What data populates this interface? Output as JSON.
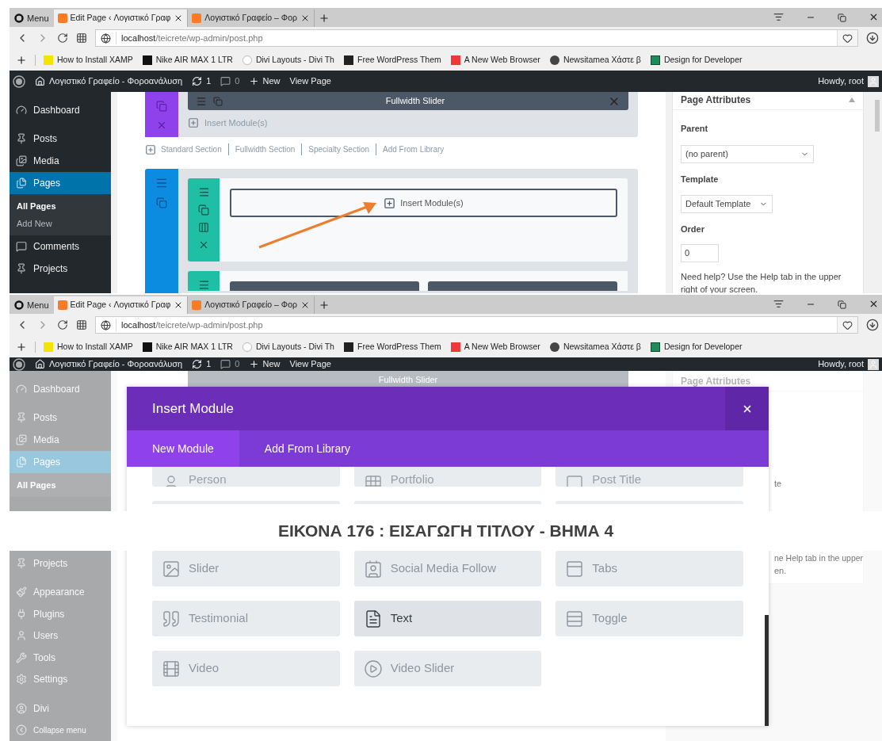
{
  "screenshots": [
    {
      "browser": {
        "menu": "Menu",
        "tabs": [
          {
            "title": "Edit Page ‹ Λογιστικό Γραφ",
            "selected": true
          },
          {
            "title": "Λογιστικό Γραφείο – Φορ",
            "selected": false
          }
        ],
        "address": {
          "host": "localhost",
          "path": "/teicrete/wp-admin/post.php"
        },
        "bookmarks": [
          {
            "label": "How to Install XAMP",
            "kind": "xampp"
          },
          {
            "label": "Nike AIR MAX 1 LTR",
            "kind": "nike"
          },
          {
            "label": "Divi Layouts - Divi Th",
            "kind": "divi"
          },
          {
            "label": "Free WordPress Them",
            "kind": "page"
          },
          {
            "label": "A New Web Browser",
            "kind": "vivaldi"
          },
          {
            "label": "Newsitamea Χάστε β",
            "kind": "news"
          },
          {
            "label": "Design for Developer",
            "kind": "design"
          }
        ]
      },
      "admin_bar": {
        "site": "Λογιστικό Γραφείο - Φοροανάλυση",
        "updates": "1",
        "comments": "0",
        "new": "New",
        "view": "View Page",
        "howdy": "Howdy, root"
      },
      "sidebar": [
        {
          "label": "Dashboard",
          "kind": "dashboard",
          "selected": false
        },
        {
          "label": "Posts",
          "kind": "pin",
          "selected": false
        },
        {
          "label": "Media",
          "kind": "media",
          "selected": false
        },
        {
          "label": "Pages",
          "kind": "pages",
          "selected": true,
          "children": [
            {
              "label": "All Pages",
              "selected": true
            },
            {
              "label": "Add New",
              "selected": false
            }
          ]
        },
        {
          "label": "Comments",
          "kind": "comments",
          "selected": false
        },
        {
          "label": "Projects",
          "kind": "pin",
          "selected": false
        }
      ],
      "builder": {
        "fullwidth_module": "Fullwidth Slider",
        "section_insert": "Insert Module(s)",
        "add_links": [
          "Standard Section",
          "Fullwidth Section",
          "Specialty Section",
          "Add From Library"
        ],
        "row_insert": "Insert Module(s)"
      },
      "page_attributes": {
        "title": "Page Attributes",
        "parent_label": "Parent",
        "parent_value": "(no parent)",
        "template_label": "Template",
        "template_value": "Default Template",
        "order_label": "Order",
        "order_value": "0",
        "help": "Need help? Use the Help tab in the upper right of your screen."
      }
    },
    {
      "browser": {
        "menu": "Menu",
        "tabs": [
          {
            "title": "Edit Page ‹ Λογιστικό Γραφ",
            "selected": true
          },
          {
            "title": "Λογιστικό Γραφείο – Φορ",
            "selected": false
          }
        ],
        "address": {
          "host": "localhost",
          "path": "/teicrete/wp-admin/post.php"
        },
        "bookmarks": [
          {
            "label": "How to Install XAMP",
            "kind": "xampp"
          },
          {
            "label": "Nike AIR MAX 1 LTR",
            "kind": "nike"
          },
          {
            "label": "Divi Layouts - Divi Th",
            "kind": "divi"
          },
          {
            "label": "Free WordPress Them",
            "kind": "page"
          },
          {
            "label": "A New Web Browser",
            "kind": "vivaldi"
          },
          {
            "label": "Newsitamea Χάστε β",
            "kind": "news"
          },
          {
            "label": "Design for Developer",
            "kind": "design"
          }
        ]
      },
      "admin_bar": {
        "site": "Λογιστικό Γραφείο - Φοροανάλυση",
        "updates": "1",
        "comments": "0",
        "new": "New",
        "view": "View Page",
        "howdy": "Howdy, root"
      },
      "sidebar_top": [
        {
          "label": "Dashboard",
          "kind": "dashboard",
          "selected": false
        },
        {
          "label": "Posts",
          "kind": "pin",
          "selected": false
        },
        {
          "label": "Media",
          "kind": "media",
          "selected": false
        },
        {
          "label": "Pages",
          "kind": "pages",
          "selected": true,
          "children": [
            {
              "label": "All Pages",
              "selected": true
            }
          ]
        }
      ],
      "sidebar_bottom": [
        {
          "label": "Projects",
          "kind": "pin",
          "selected": false
        },
        {
          "label": "Appearance",
          "kind": "brush",
          "selected": false
        },
        {
          "label": "Plugins",
          "kind": "plug",
          "selected": false
        },
        {
          "label": "Users",
          "kind": "user",
          "selected": false
        },
        {
          "label": "Tools",
          "kind": "wrench",
          "selected": false
        },
        {
          "label": "Settings",
          "kind": "settings",
          "selected": false
        },
        {
          "label": "Divi",
          "kind": "divi",
          "selected": false
        },
        {
          "label": "Collapse menu",
          "kind": "collapse",
          "selected": false
        }
      ],
      "background": {
        "fullwidth_module": "Fullwidth Slider",
        "panel_title": "Page Attributes",
        "template_fragment": "te",
        "help_fragment": "ne Help tab in the upper",
        "help_fragment_2": "en."
      },
      "modal": {
        "title": "Insert Module",
        "tabs": [
          {
            "label": "New Module",
            "selected": true
          },
          {
            "label": "Add From Library",
            "selected": false
          }
        ],
        "partial_modules": [
          {
            "label": "Person",
            "kind": "person"
          },
          {
            "label": "Portfolio",
            "kind": "grid"
          },
          {
            "label": "Post Title",
            "kind": "title"
          }
        ],
        "modules": [
          {
            "label": "Slider",
            "kind": "slider",
            "selected": false
          },
          {
            "label": "Social Media Follow",
            "kind": "social",
            "selected": false
          },
          {
            "label": "Tabs",
            "kind": "tabs",
            "selected": false
          },
          {
            "label": "Testimonial",
            "kind": "quote",
            "selected": false
          },
          {
            "label": "Text",
            "kind": "text",
            "selected": true
          },
          {
            "label": "Toggle",
            "kind": "toggle",
            "selected": false
          },
          {
            "label": "Video",
            "kind": "video",
            "selected": false
          },
          {
            "label": "Video Slider",
            "kind": "videoslider",
            "selected": false
          }
        ]
      }
    }
  ],
  "caption": "ΕΙΚΟΝΑ 176 : ΕΙΣΑΓΩΓΗ ΤΙΤΛΟΥ - ΒΗΜΑ 4"
}
